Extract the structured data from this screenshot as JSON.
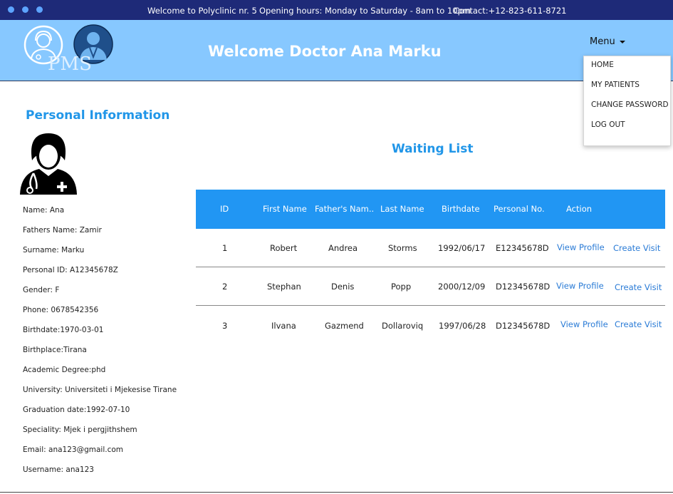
{
  "topbar": {
    "welcome": "Welcome to Polyclinic nr. 5",
    "hours": "Opening hours: Monday to Saturday - 8am to 10pm",
    "contact": "Contact:+12-823-611-8721"
  },
  "header": {
    "logo_text": "PMS",
    "welcome_title": "Welcome Doctor Ana Marku",
    "menu_label": "Menu",
    "menu_items": [
      "HOME",
      "MY PATIENTS",
      "CHANGE PASSWORD",
      "LOG OUT"
    ]
  },
  "personal": {
    "title": "Personal Information",
    "lines": [
      "Name: Ana",
      "Fathers Name: Zamir",
      "Surname: Marku",
      "Personal ID: A12345678Z",
      "Gender: F",
      "Phone: 0678542356",
      "Birthdate:1970-03-01",
      "Birthplace:Tirana",
      "Academic Degree:phd",
      "University: Universiteti i Mjekesise Tirane",
      "Graduation date:1992-07-10",
      "Speciality: Mjek i pergjithshem",
      "Email: ana123@gmail.com",
      "Username: ana123"
    ]
  },
  "waiting": {
    "title": "Waiting List",
    "headers": [
      "ID",
      "First Name",
      "Father's Nam..",
      "Last Name",
      "Birthdate",
      "Personal No.",
      "Action"
    ],
    "rows": [
      {
        "id": "1",
        "first": "Robert",
        "father": "Andrea",
        "last": "Storms",
        "birthdate": "1992/06/17",
        "personal_no": "E12345678D",
        "view": "View Profile",
        "create": "Create Visit"
      },
      {
        "id": "2",
        "first": "Stephan",
        "father": "Denis",
        "last": "Popp",
        "birthdate": "2000/12/09",
        "personal_no": "D12345678D",
        "view": "View Profile",
        "create": "Create Visit"
      },
      {
        "id": "3",
        "first": "Ilvana",
        "father": "Gazmend",
        "last": "Dollaroviq",
        "birthdate": "1997/06/28",
        "personal_no": "D12345678D",
        "view": "View Profile",
        "create": "Create Visit"
      }
    ]
  },
  "colors": {
    "titlebar": "#1e2a78",
    "header": "#87c8ff",
    "accent": "#2196e8",
    "table_header": "#2196f3",
    "link": "#2a7bd6"
  },
  "icons": [
    "window-dot-icon",
    "female-doctor-logo-icon",
    "male-doctor-logo-icon",
    "female-doctor-avatar-icon",
    "caret-down-icon"
  ]
}
